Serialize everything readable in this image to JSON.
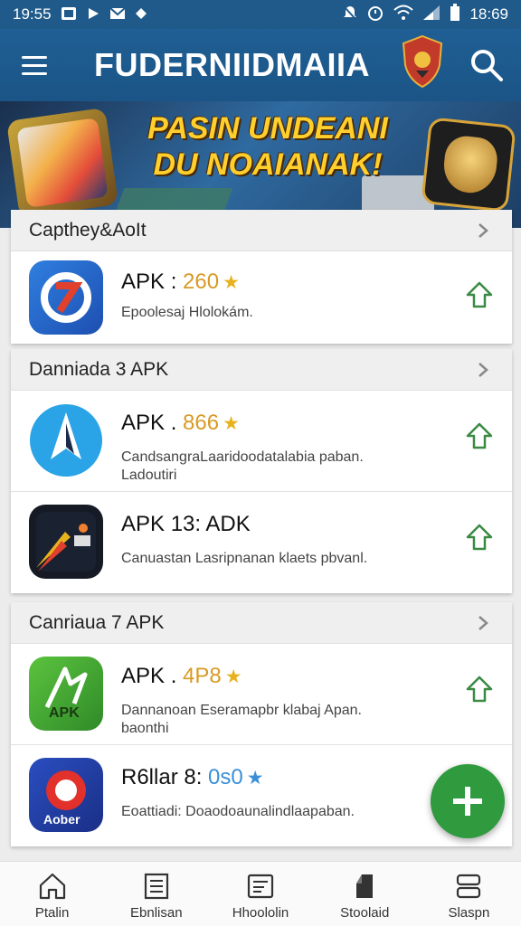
{
  "status_bar": {
    "time_left": "19:55",
    "time_right": "18:69"
  },
  "app_bar": {
    "title": "FUDERNIIDMAIIA"
  },
  "banner": {
    "line1": "PASIN UNDEANI",
    "line2": "DU NOAIANAK!"
  },
  "sections": [
    {
      "header": "Capthey&AoIt",
      "items": [
        {
          "name": "APK :",
          "rating": "260",
          "rating_color": "orange",
          "description": "Epoolesaj Hlolokám."
        }
      ]
    },
    {
      "header": "Danniada 3 APK",
      "items": [
        {
          "name": "APK .",
          "rating": "866",
          "rating_color": "orange",
          "description": "CandsangraLaaridoodatalabia paban. Ladoutiri"
        },
        {
          "name": "APK 13: ADK",
          "rating": "",
          "rating_color": "",
          "description": "Canuastan Lasripnanan klaets pbvanl."
        }
      ]
    },
    {
      "header": "Canriaua 7 APK",
      "items": [
        {
          "name": "APK .",
          "rating": "4P8",
          "rating_color": "orange",
          "description": "Dannanoan Eseramapbr klabaj Apan. baonthi"
        },
        {
          "name": "R6llar 8:",
          "rating": "0s0",
          "rating_color": "blue",
          "description": "Eoattiadi: Doaodoaunalindlaapaban."
        }
      ]
    }
  ],
  "icon_badges": {
    "apk_green": "APK",
    "aober": "Aober"
  },
  "bottom_nav": [
    {
      "label": "Ptalin",
      "icon": "home-icon"
    },
    {
      "label": "Ebnlisan",
      "icon": "list-icon"
    },
    {
      "label": "Hhoololin",
      "icon": "document-icon"
    },
    {
      "label": "Stoolaid",
      "icon": "tag-icon"
    },
    {
      "label": "Slaspn",
      "icon": "storage-icon"
    }
  ]
}
